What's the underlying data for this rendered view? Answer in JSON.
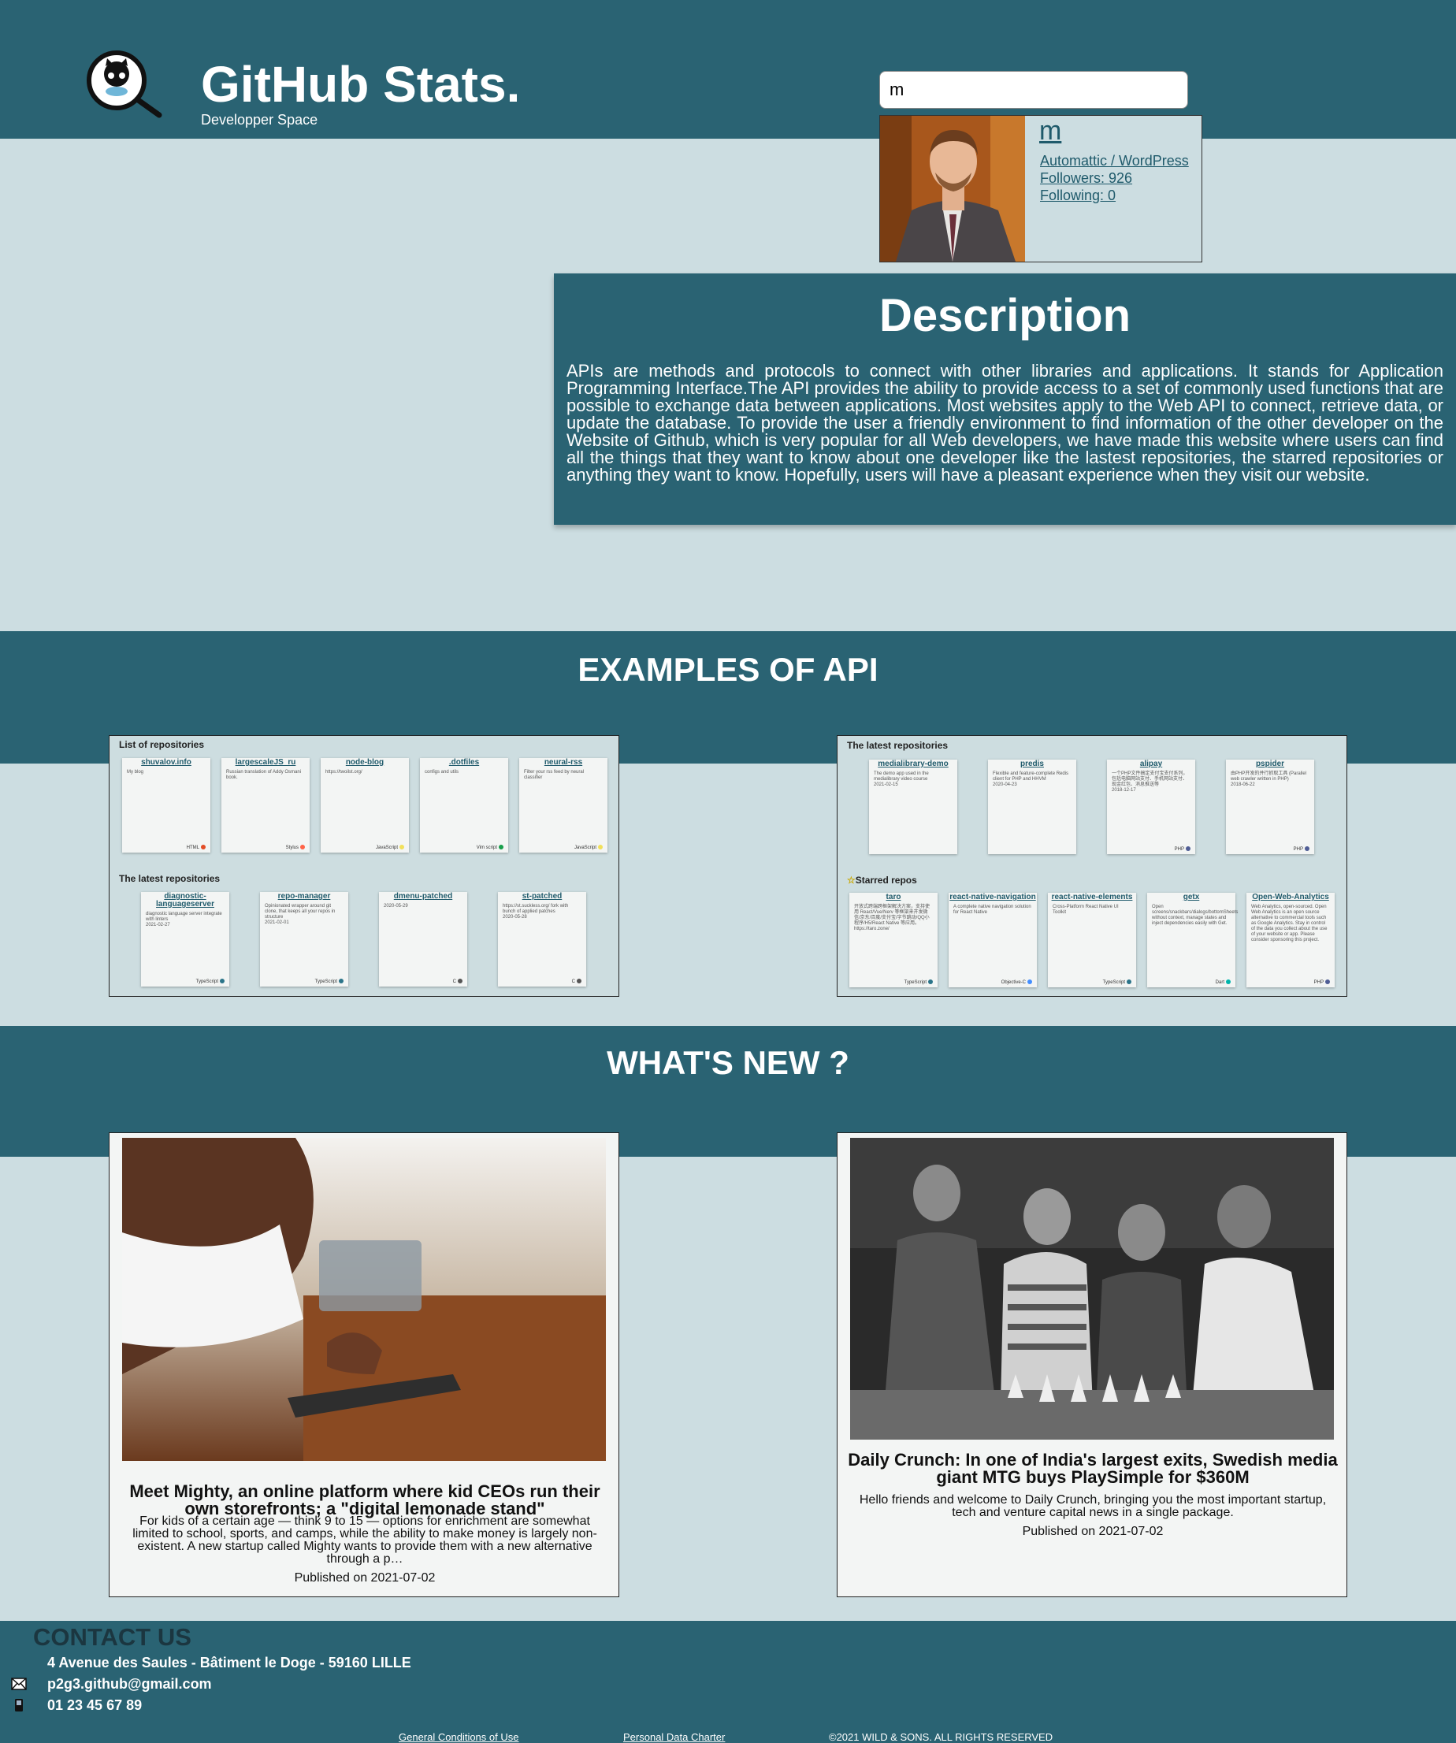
{
  "header": {
    "title": "GitHub Stats.",
    "subtitle": "Developper Space",
    "search_value": "m"
  },
  "user": {
    "login": "m",
    "company": "Automattic / WordPress",
    "followers": "Followers: 926",
    "following": "Following: 0"
  },
  "description": {
    "title": "Description",
    "text": "APIs are methods and protocols to connect with other libraries and applications. It stands for Application Programming Interface.The API provides the ability to provide access to a set of commonly used functions that are possible to exchange data between applications. Most websites apply to the Web API to connect, retrieve data, or update the database. To provide the user a friendly environment to find information of the other developer on the Website of Github, which is very popular for all Web developers, we have made this website where users can find all the things that they want to know about one developer like the lastest repositories, the starred repositories or anything they want to know. Hopefully, users will have a pleasant experience when they visit our website."
  },
  "examples": {
    "title": "EXAMPLES OF API",
    "left": {
      "repos_heading": "List of repositories",
      "repos": [
        {
          "name": "shuvalov.info",
          "desc": "My blog",
          "date": "",
          "lang": "HTML",
          "color": "#e34c26"
        },
        {
          "name": "largescaleJS_ru",
          "desc": "Russian translation of Addy Osmani book.",
          "date": "",
          "lang": "Stylus",
          "color": "#ff6347"
        },
        {
          "name": "node-blog",
          "desc": "https://twoilst.org/",
          "date": "",
          "lang": "JavaScript",
          "color": "#f1e05a"
        },
        {
          "name": ".dotfiles",
          "desc": "configs and utils",
          "date": "",
          "lang": "Vim script",
          "color": "#199f4b"
        },
        {
          "name": "neural-rss",
          "desc": "Filter your rss feed by neural classifier",
          "date": "",
          "lang": "JavaScript",
          "color": "#f1e05a"
        }
      ],
      "latest_heading": "The latest repositories",
      "latest": [
        {
          "name": "diagnostic-languageserver",
          "desc": "diagnostic language server integrate with linters",
          "date": "2021-02-27",
          "lang": "TypeScript",
          "color": "#2b7489"
        },
        {
          "name": "repo-manager",
          "desc": "Opinionated wrapper around git clone, that keeps all your repos in structure",
          "date": "2021-02-01",
          "lang": "TypeScript",
          "color": "#2b7489"
        },
        {
          "name": "dmenu-patched",
          "desc": "",
          "date": "2020-05-29",
          "lang": "C",
          "color": "#555555"
        },
        {
          "name": "st-patched",
          "desc": "https://st.suckless.org/ fork with bunch of applied patches",
          "date": "2020-05-28",
          "lang": "C",
          "color": "#555555"
        }
      ]
    },
    "right": {
      "latest_heading": "The latest repositories",
      "latest": [
        {
          "name": "medialibrary-demo",
          "desc": "The demo app used in the medialibrary video course",
          "date": "2021-02-15",
          "lang": "",
          "color": ""
        },
        {
          "name": "predis",
          "desc": "Flexible and feature-complete Redis client for PHP and HHVM",
          "date": "2020-04-23",
          "lang": "",
          "color": ""
        },
        {
          "name": "alipay",
          "desc": "一个PHP文件搞定支付宝支付系列，包括电脑网站支付、手机网站支付、现金红包、消息推送等",
          "date": "2018-12-17",
          "lang": "PHP",
          "color": "#4f5d95"
        },
        {
          "name": "pspider",
          "desc": "由PHP开发的并行抓取工具 (Parallel web crawler written in PHP)",
          "date": "2018-06-22",
          "lang": "PHP",
          "color": "#4f5d95"
        }
      ],
      "starred_heading": "Starred repos",
      "starred": [
        {
          "name": "taro",
          "desc": "开放式跨端跨框架解决方案，支持使用 React/Vue/Nerv 等框架来开发微信/京东/百度/支付宝/字节跳动/QQ小程序/H5/React Native 等应用。https://taro.zone/",
          "date": "",
          "lang": "TypeScript",
          "color": "#2b7489"
        },
        {
          "name": "react-native-navigation",
          "desc": "A complete native navigation solution for React Native",
          "date": "",
          "lang": "Objective-C",
          "color": "#438eff"
        },
        {
          "name": "react-native-elements",
          "desc": "Cross-Platform React Native UI Toolkit",
          "date": "",
          "lang": "TypeScript",
          "color": "#2b7489"
        },
        {
          "name": "getx",
          "desc": "Open screens/snackbars/dialogs/bottomSheets without context, manage states and inject dependencies easily with Get.",
          "date": "",
          "lang": "Dart",
          "color": "#00b4ab"
        },
        {
          "name": "Open-Web-Analytics",
          "desc": "Web Analytics, open-sourced. Open Web Analytics is an open source alternative to commercial tools such as Google Analytics. Stay in control of the data you collect about the use of your website or app. Please consider sponsoring this project.",
          "date": "",
          "lang": "PHP",
          "color": "#4f5d95"
        }
      ]
    }
  },
  "news": {
    "title": "WHAT'S NEW ?",
    "articles": [
      {
        "title": "Meet Mighty, an online platform where kid CEOs run their own storefronts; a \"digital lemonade stand\"",
        "text": "For kids of a certain age — think 9 to 15 — options for enrichment are somewhat limited to school, sports, and camps, while the ability to make money is largely non-existent. A new startup called Mighty wants to provide them with a new alternative through a p…",
        "date": "Published on 2021-07-02"
      },
      {
        "title": "Daily Crunch: In one of India's largest exits, Swedish media giant MTG buys PlaySimple for $360M",
        "text": "Hello friends and welcome to Daily Crunch, bringing you the most important startup, tech and venture capital news in a single package.",
        "date": "Published on 2021-07-02"
      }
    ]
  },
  "footer": {
    "contact_title": "CONTACT US",
    "address": "4 Avenue des Saules - Bâtiment le Doge - 59160 LILLE",
    "email": "p2g3.github@gmail.com",
    "phone": "01 23 45 67 89",
    "conditions": "General Conditions of Use",
    "privacy": "Personal Data Charter",
    "copyright": "©2021 WILD & SONS. ALL RIGHTS RESERVED"
  },
  "colors": {
    "primary": "#2a6373",
    "background": "#ccdde1",
    "card": "#f3f5f4"
  }
}
